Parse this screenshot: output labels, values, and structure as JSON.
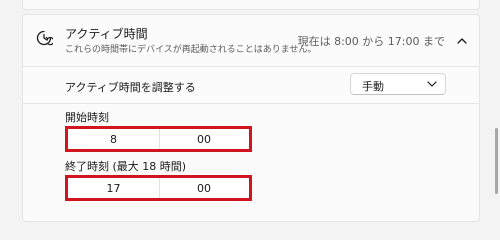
{
  "active_hours": {
    "title": "アクティブ時間",
    "subtitle": "これらの時間帯にデバイスが再起動されることはありません。",
    "status": "現在は 8:00 から 17:00 まで",
    "expanded": true,
    "icon": "clock-refresh-icon"
  },
  "adjust": {
    "label": "アクティブ時間を調整する",
    "dropdown_value": "手動"
  },
  "start_time": {
    "label": "開始時刻",
    "hour": "8",
    "minute": "00"
  },
  "end_time": {
    "label": "終了時刻 (最大 18 時間)",
    "hour": "17",
    "minute": "00"
  },
  "colors": {
    "highlight": "#d1141d",
    "panel_background": "#fbfbfb",
    "page_background": "#f3f3f3"
  }
}
